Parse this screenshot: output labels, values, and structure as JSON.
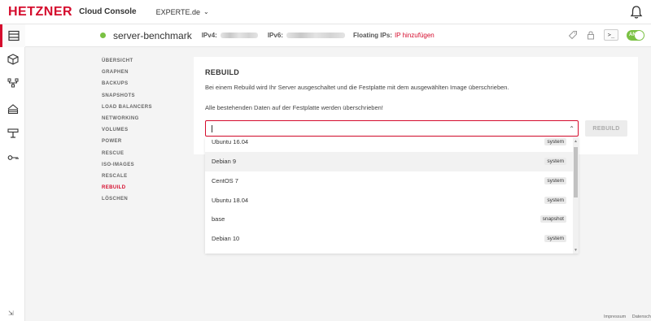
{
  "topbar": {
    "logo": "HETZNER",
    "app_title": "Cloud Console",
    "project": "EXPERTE.de"
  },
  "rail": {
    "icons": [
      "servers-icon",
      "volumes-icon",
      "network-icon",
      "load-balancer-icon",
      "firewall-icon",
      "key-icon"
    ],
    "bottom_icon": "expand-icon"
  },
  "server": {
    "name": "server-benchmark",
    "ipv4_label": "IPv4:",
    "ipv6_label": "IPv6:",
    "floating_label": "Floating IPs:",
    "floating_link": "IP hinzufügen",
    "power_label": "AN",
    "console_label": ">_",
    "status_color": "#7ac143"
  },
  "subnav": {
    "items": [
      "ÜBERSICHT",
      "GRAPHEN",
      "BACKUPS",
      "SNAPSHOTS",
      "LOAD BALANCERS",
      "NETWORKING",
      "VOLUMES",
      "POWER",
      "RESCUE",
      "ISO-IMAGES",
      "RESCALE",
      "REBUILD",
      "LÖSCHEN"
    ],
    "active": "REBUILD"
  },
  "panel": {
    "title": "REBUILD",
    "text1": "Bei einem Rebuild wird Ihr Server ausgeschaltet und die Festplatte mit dem ausgewählten Image überschrieben.",
    "text2": "Alle bestehenden Daten auf der Festplatte werden überschrieben!",
    "select_value": "",
    "rebuild_button": "REBUILD"
  },
  "dropdown": {
    "items": [
      {
        "label": "Ubuntu 16.04",
        "tag": "system"
      },
      {
        "label": "Debian 9",
        "tag": "system"
      },
      {
        "label": "CentOS 7",
        "tag": "system"
      },
      {
        "label": "Ubuntu 18.04",
        "tag": "system"
      },
      {
        "label": "base",
        "tag": "snapshot"
      },
      {
        "label": "Debian 10",
        "tag": "system"
      }
    ],
    "highlighted_index": 1
  },
  "footer": {
    "impressum": "Impressum",
    "datenschutz": "Datensch"
  },
  "colors": {
    "brand": "#d50c2d",
    "status_green": "#7ac143"
  }
}
